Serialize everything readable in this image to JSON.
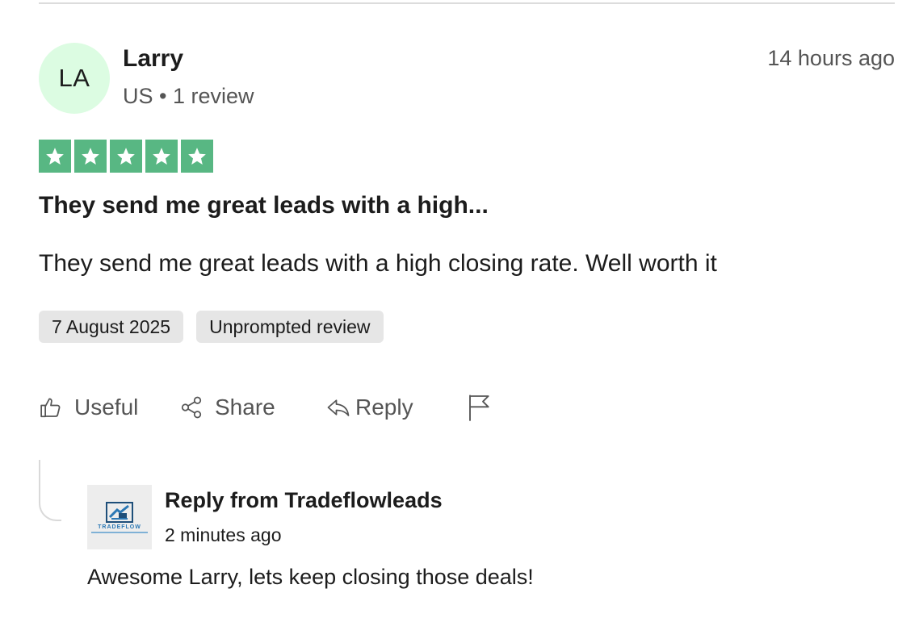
{
  "reviewer": {
    "initials": "LA",
    "name": "Larry",
    "meta": "US • 1 review",
    "posted_ago": "14 hours ago",
    "avatar_color": "#dcfce2"
  },
  "review": {
    "rating": 5,
    "star_color": "#58b783",
    "title": "They send me great leads with a high...",
    "body": "They send me great leads with a high closing rate. Well worth it",
    "tags": [
      "7 August 2025",
      "Unprompted review"
    ]
  },
  "actions": {
    "useful_label": "Useful",
    "share_label": "Share",
    "reply_label": "Reply",
    "useful_icon": "thumbs-up-icon",
    "share_icon": "share-icon",
    "reply_icon": "reply-arrow-icon",
    "report_icon": "flag-icon"
  },
  "company_reply": {
    "logo_text": "TRADEFLOW",
    "title": "Reply from Tradeflowleads",
    "time": "2 minutes ago",
    "body": "Awesome Larry, lets keep closing those deals!"
  }
}
